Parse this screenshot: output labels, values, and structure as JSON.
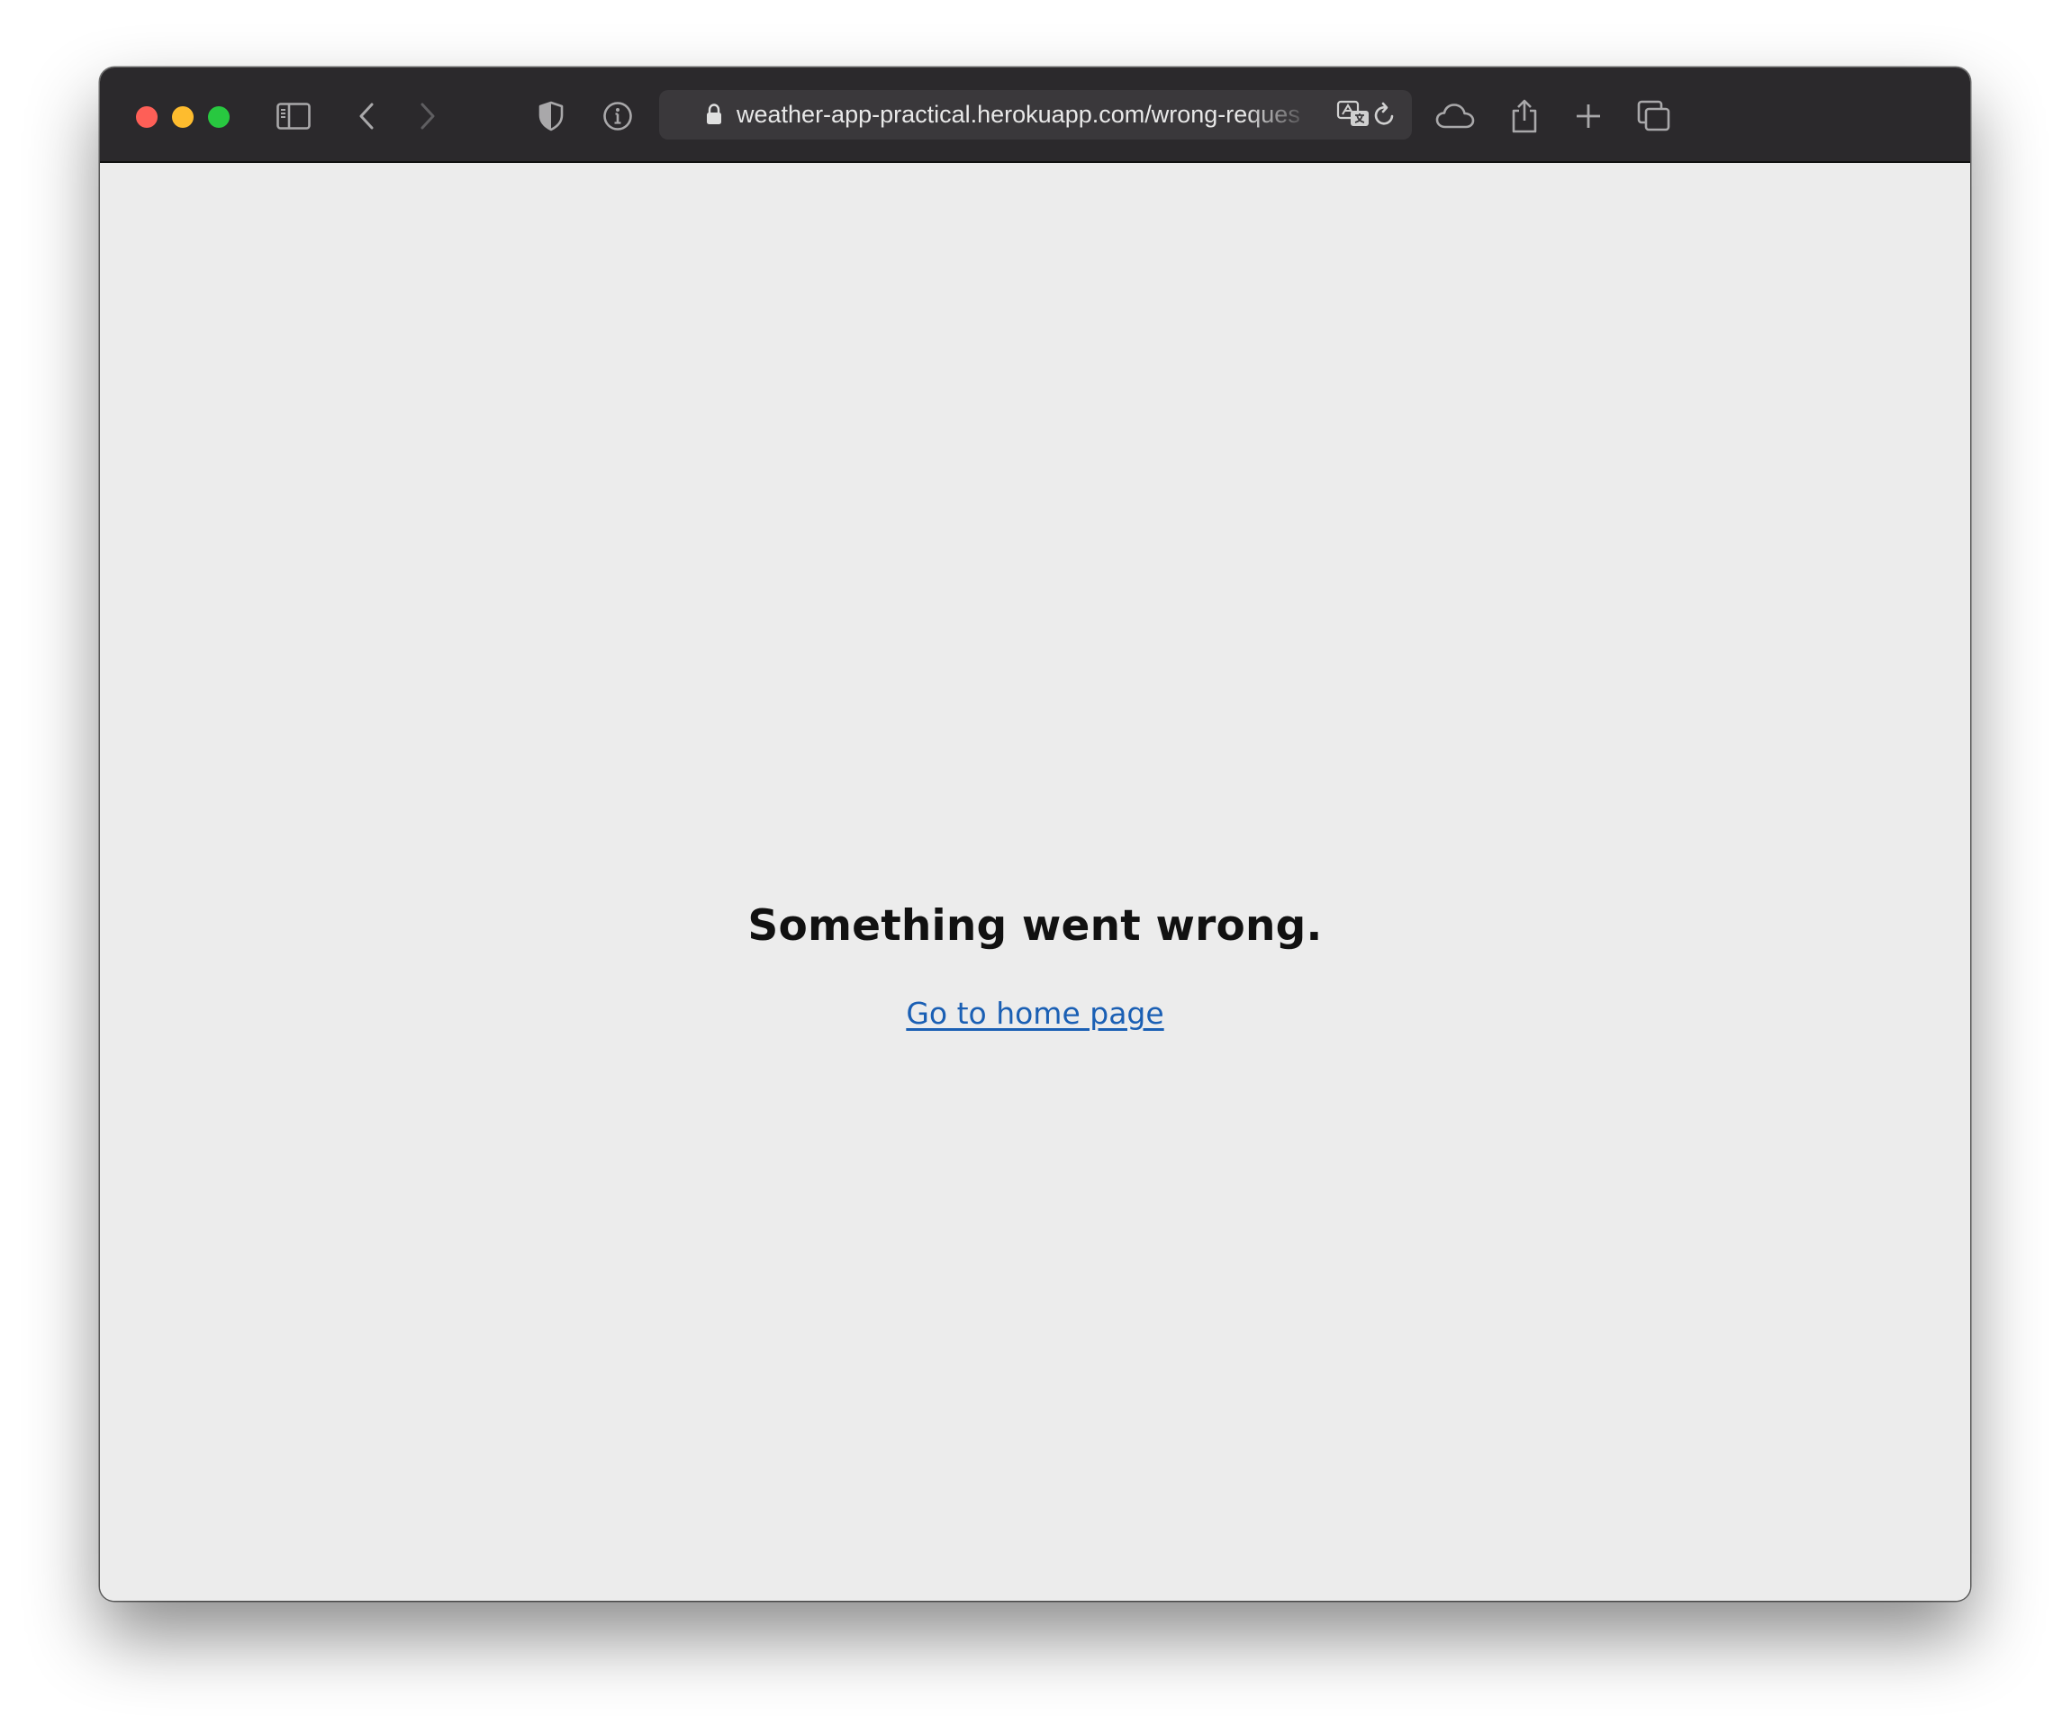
{
  "browser": {
    "url": "weather-app-practical.herokuapp.com/wrong-reques",
    "colors": {
      "toolbar": "#2b292c",
      "address_bar": "#3a383b",
      "page_background": "#ececec",
      "link": "#1a5fb4",
      "close": "#fe5f57",
      "minimize": "#febc2e",
      "zoom": "#28c840"
    },
    "toolbar_icons": [
      "sidebar-icon",
      "back-icon",
      "forward-icon",
      "privacy-shield-icon",
      "info-icon",
      "lock-icon",
      "translate-icon",
      "reload-icon",
      "cloud-icon",
      "share-icon",
      "new-tab-icon",
      "tab-overview-icon"
    ]
  },
  "page": {
    "title": "Something went wrong.",
    "link_text": "Go to home page"
  }
}
